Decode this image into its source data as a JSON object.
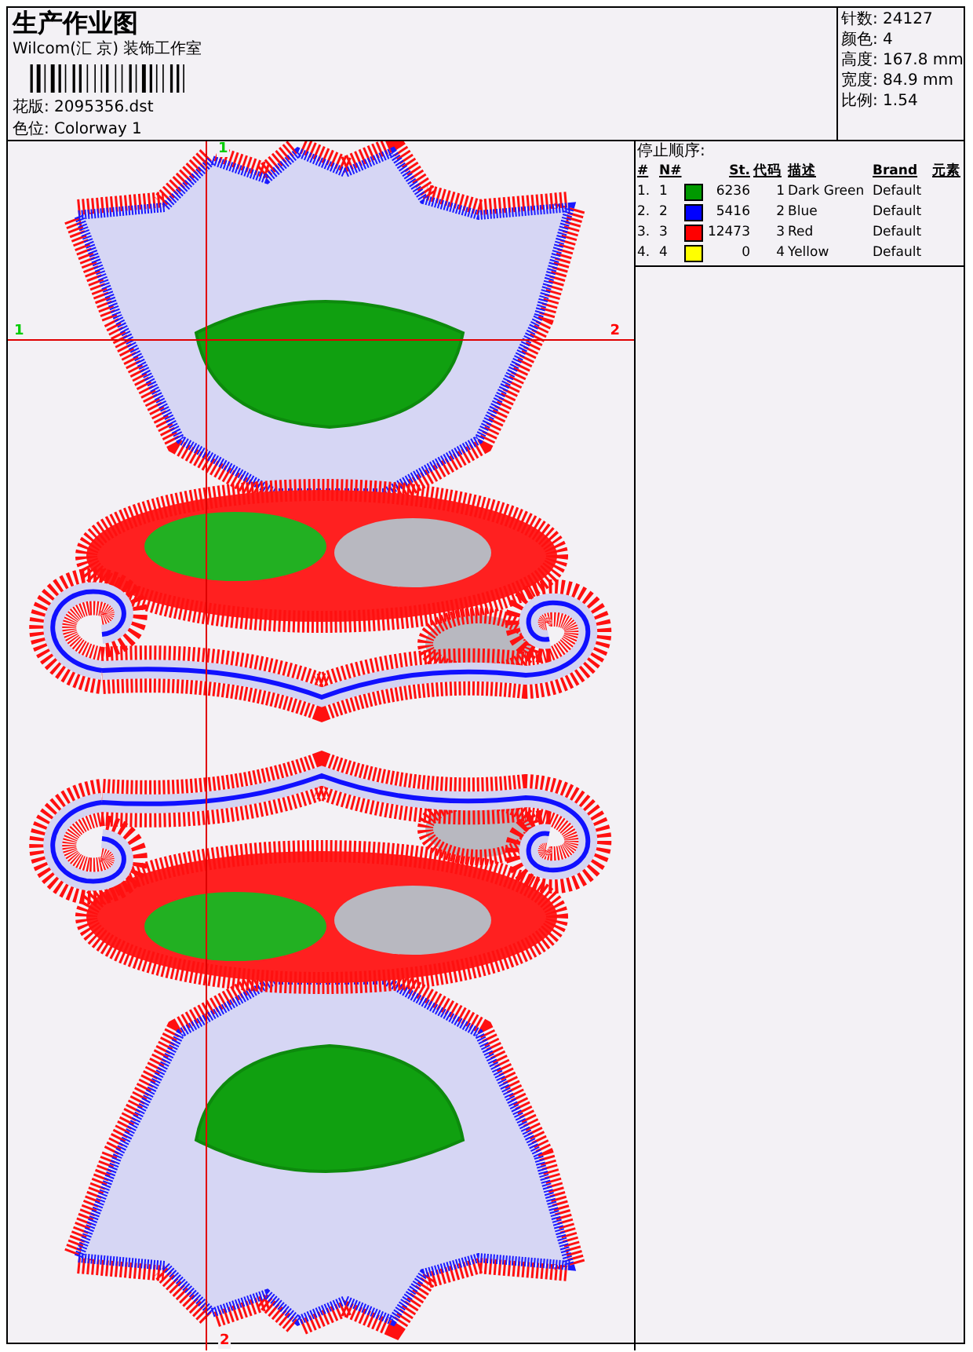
{
  "header": {
    "title": "生产作业图",
    "company": "Wilcom(汇 京) 装饰工作室",
    "design": "花版: 2095356.dst",
    "colorway": "色位: Colorway 1"
  },
  "stats": [
    "针数: 24127",
    "颜色: 4",
    "高度: 167.8 mm",
    "宽度: 84.9 mm",
    "比例: 1.54"
  ],
  "stop_sequence": {
    "title": "停止顺序:",
    "columns": [
      "#",
      "N#",
      "St.",
      "代码",
      "描述",
      "Brand",
      "元素"
    ],
    "rows": [
      {
        "index": "1.",
        "number": "1",
        "color": "#009900",
        "stitches": "6236",
        "code": "1",
        "description": "Dark Green",
        "brand": "Default"
      },
      {
        "index": "2.",
        "number": "2",
        "color": "#0000ff",
        "stitches": "5416",
        "code": "2",
        "description": "Blue",
        "brand": "Default"
      },
      {
        "index": "3.",
        "number": "3",
        "color": "#ff0000",
        "stitches": "12473",
        "code": "3",
        "description": "Red",
        "brand": "Default"
      },
      {
        "index": "4.",
        "number": "4",
        "color": "#ffff00",
        "stitches": "0",
        "code": "4",
        "description": "Yellow",
        "brand": "Default"
      }
    ]
  },
  "canvas": {
    "markers": [
      {
        "label": "1",
        "color": "#00cc00"
      },
      {
        "label": "1",
        "color": "#00cc00"
      },
      {
        "label": "2",
        "color": "#ff0000"
      },
      {
        "label": "2",
        "color": "#ff0000"
      }
    ]
  }
}
